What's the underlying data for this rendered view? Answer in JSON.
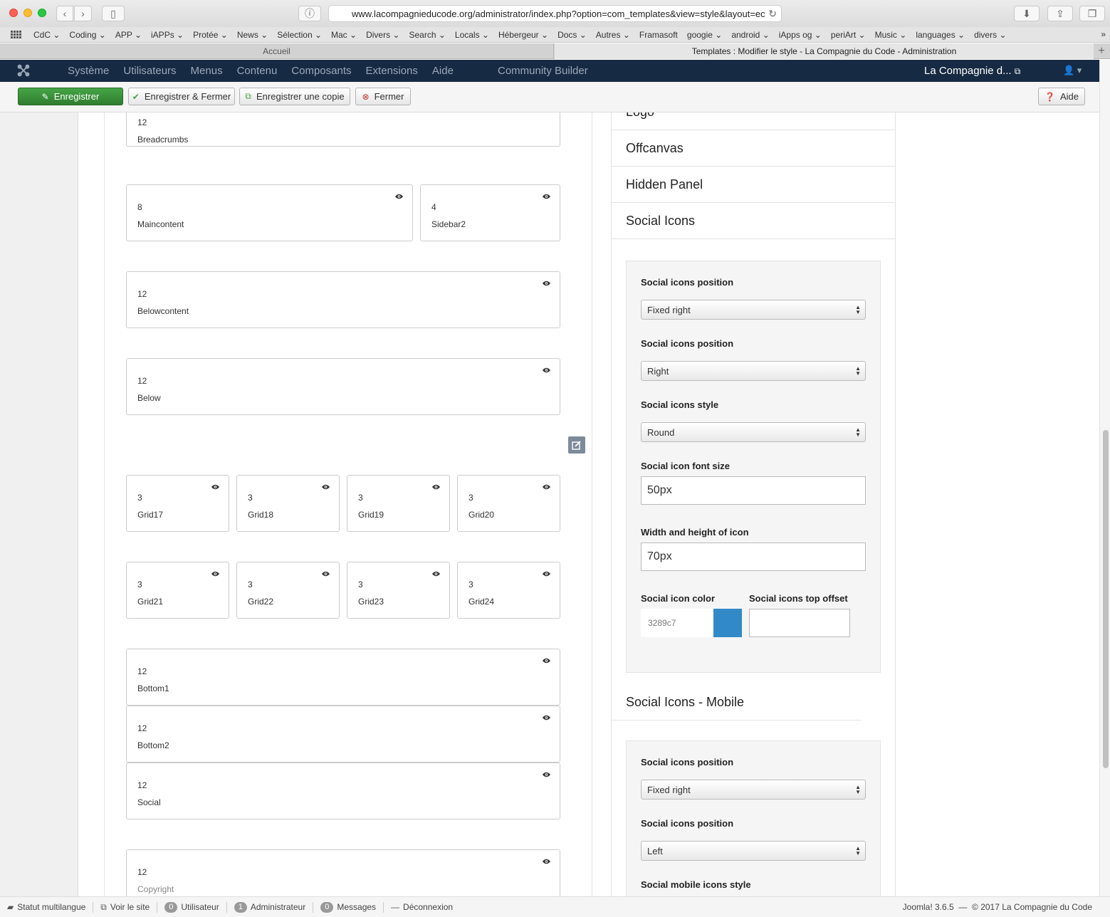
{
  "browser": {
    "url": "www.lacompagnieducode.org/administrator/index.php?option=com_templates&view=style&layout=ec",
    "bookmarks": [
      "CdC",
      "Coding",
      "APP",
      "iAPPs",
      "Protée",
      "News",
      "Sélection",
      "Mac",
      "Divers",
      "Search",
      "Locals",
      "Hébergeur",
      "Docs",
      "Autres",
      "Framasoft",
      "googie",
      "android",
      "iApps og",
      "periArt",
      "Music",
      "languages",
      "divers"
    ],
    "tabs": [
      "Accueil",
      "Templates : Modifier le style - La Compagnie du Code - Administration"
    ]
  },
  "nav": {
    "menu": [
      "Système",
      "Utilisateurs",
      "Menus",
      "Contenu",
      "Composants",
      "Extensions",
      "Aide"
    ],
    "community": "Community Builder",
    "site": "La Compagnie d..."
  },
  "toolbar": {
    "save": "Enregistrer",
    "save_close": "Enregistrer & Fermer",
    "save_copy": "Enregistrer une copie",
    "close": "Fermer",
    "help": "Aide"
  },
  "positions": [
    {
      "size": "12",
      "name": "Breadcrumbs"
    },
    {
      "size": "8",
      "name": "Maincontent"
    },
    {
      "size": "4",
      "name": "Sidebar2"
    },
    {
      "size": "12",
      "name": "Belowcontent"
    },
    {
      "size": "12",
      "name": "Below"
    },
    {
      "size": "3",
      "name": "Grid17"
    },
    {
      "size": "3",
      "name": "Grid18"
    },
    {
      "size": "3",
      "name": "Grid19"
    },
    {
      "size": "3",
      "name": "Grid20"
    },
    {
      "size": "3",
      "name": "Grid21"
    },
    {
      "size": "3",
      "name": "Grid22"
    },
    {
      "size": "3",
      "name": "Grid23"
    },
    {
      "size": "3",
      "name": "Grid24"
    },
    {
      "size": "12",
      "name": "Bottom1"
    },
    {
      "size": "12",
      "name": "Bottom2"
    },
    {
      "size": "12",
      "name": "Social"
    },
    {
      "size": "12",
      "name": "Copyright"
    }
  ],
  "panel": {
    "sections": [
      "Logo",
      "Offcanvas",
      "Hidden Panel",
      "Social Icons"
    ],
    "social": {
      "pos_label_1": "Social icons position",
      "pos_value_1": "Fixed right",
      "pos_label_2": "Social icons position",
      "pos_value_2": "Right",
      "style_label": "Social icons style",
      "style_value": "Round",
      "font_label": "Social icon font size",
      "font_value": "50px",
      "wh_label": "Width and height of icon",
      "wh_value": "70px",
      "color_label": "Social icon color",
      "color_value": "3289c7",
      "color_swatch": "#3289c7",
      "offset_label": "Social icons top offset"
    },
    "mobile_title": "Social Icons - Mobile",
    "mobile": {
      "pos_label_1": "Social icons position",
      "pos_value_1": "Fixed right",
      "pos_label_2": "Social icons position",
      "pos_value_2": "Left",
      "style_label": "Social mobile icons style"
    }
  },
  "status": {
    "multilang": "Statut multilangue",
    "view_site": "Voir le site",
    "users_count": "0",
    "users": "Utilisateur",
    "admin_count": "1",
    "admin": "Administrateur",
    "msg_count": "0",
    "messages": "Messages",
    "logout": "Déconnexion",
    "version": "Joomla! 3.6.5",
    "copyright": "© 2017 La Compagnie du Code"
  }
}
